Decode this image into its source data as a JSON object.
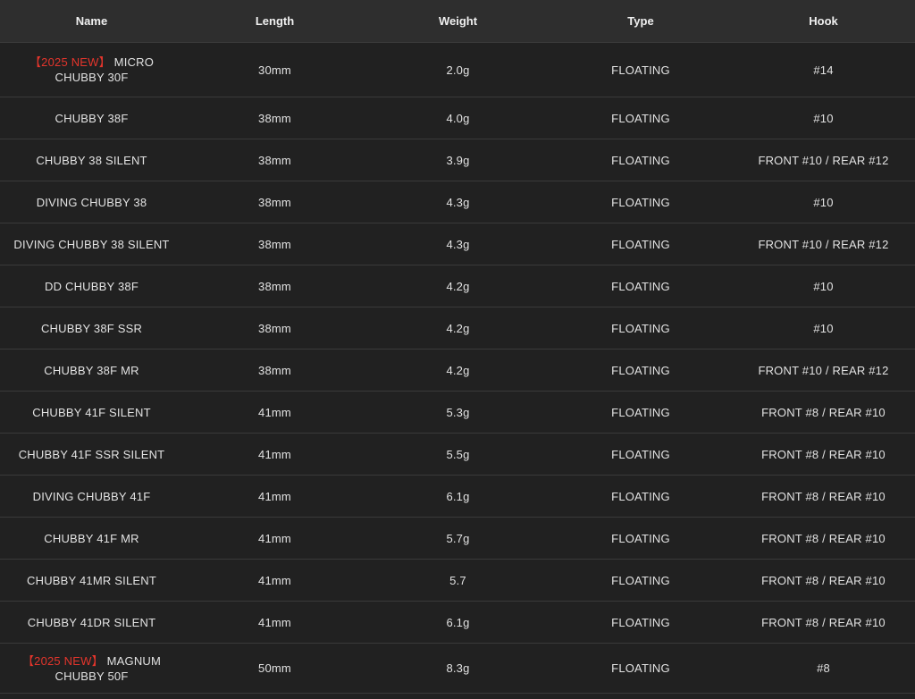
{
  "header": {
    "name": "Name",
    "length": "Length",
    "weight": "Weight",
    "type": "Type",
    "hook": "Hook"
  },
  "rows": [
    {
      "tag": "【2025 NEW】",
      "name_line1": "MICRO",
      "name_line2": "CHUBBY 30F",
      "length": "30mm",
      "weight": "2.0g",
      "type": "FLOATING",
      "hook": "#14"
    },
    {
      "name": "CHUBBY 38F",
      "length": "38mm",
      "weight": "4.0g",
      "type": "FLOATING",
      "hook": "#10"
    },
    {
      "name": "CHUBBY 38 SILENT",
      "length": "38mm",
      "weight": "3.9g",
      "type": "FLOATING",
      "hook": "FRONT #10 / REAR #12"
    },
    {
      "name": "DIVING CHUBBY 38",
      "length": "38mm",
      "weight": "4.3g",
      "type": "FLOATING",
      "hook": "#10"
    },
    {
      "name": "DIVING CHUBBY 38 SILENT",
      "length": "38mm",
      "weight": "4.3g",
      "type": "FLOATING",
      "hook": "FRONT #10 / REAR #12"
    },
    {
      "name": "DD CHUBBY 38F",
      "length": "38mm",
      "weight": "4.2g",
      "type": "FLOATING",
      "hook": "#10"
    },
    {
      "name": "CHUBBY 38F SSR",
      "length": "38mm",
      "weight": "4.2g",
      "type": "FLOATING",
      "hook": "#10"
    },
    {
      "name": "CHUBBY 38F MR",
      "length": "38mm",
      "weight": "4.2g",
      "type": "FLOATING",
      "hook": "FRONT #10 / REAR #12"
    },
    {
      "name": "CHUBBY 41F SILENT",
      "length": "41mm",
      "weight": "5.3g",
      "type": "FLOATING",
      "hook": "FRONT #8 / REAR #10"
    },
    {
      "name": "CHUBBY 41F SSR SILENT",
      "length": "41mm",
      "weight": "5.5g",
      "type": "FLOATING",
      "hook": "FRONT #8 / REAR #10"
    },
    {
      "name": "DIVING CHUBBY 41F",
      "length": "41mm",
      "weight": "6.1g",
      "type": "FLOATING",
      "hook": "FRONT #8 / REAR #10"
    },
    {
      "name": "CHUBBY 41F MR",
      "length": "41mm",
      "weight": "5.7g",
      "type": "FLOATING",
      "hook": "FRONT #8 / REAR #10"
    },
    {
      "name": "CHUBBY 41MR SILENT",
      "length": "41mm",
      "weight": "5.7",
      "type": "FLOATING",
      "hook": "FRONT #8 / REAR #10"
    },
    {
      "name": "CHUBBY 41DR SILENT",
      "length": "41mm",
      "weight": "6.1g",
      "type": "FLOATING",
      "hook": "FRONT #8 / REAR #10"
    },
    {
      "tag": "【2025 NEW】",
      "name_line1": "MAGNUM",
      "name_line2": "CHUBBY 50F",
      "length": "50mm",
      "weight": "8.3g",
      "type": "FLOATING",
      "hook": "#8"
    }
  ],
  "colors": {
    "background": "#212121",
    "header_background": "#2e2e2e",
    "divider": "#3a3a3a",
    "text": "#e2e2e2",
    "new_tag": "#e4352c"
  }
}
